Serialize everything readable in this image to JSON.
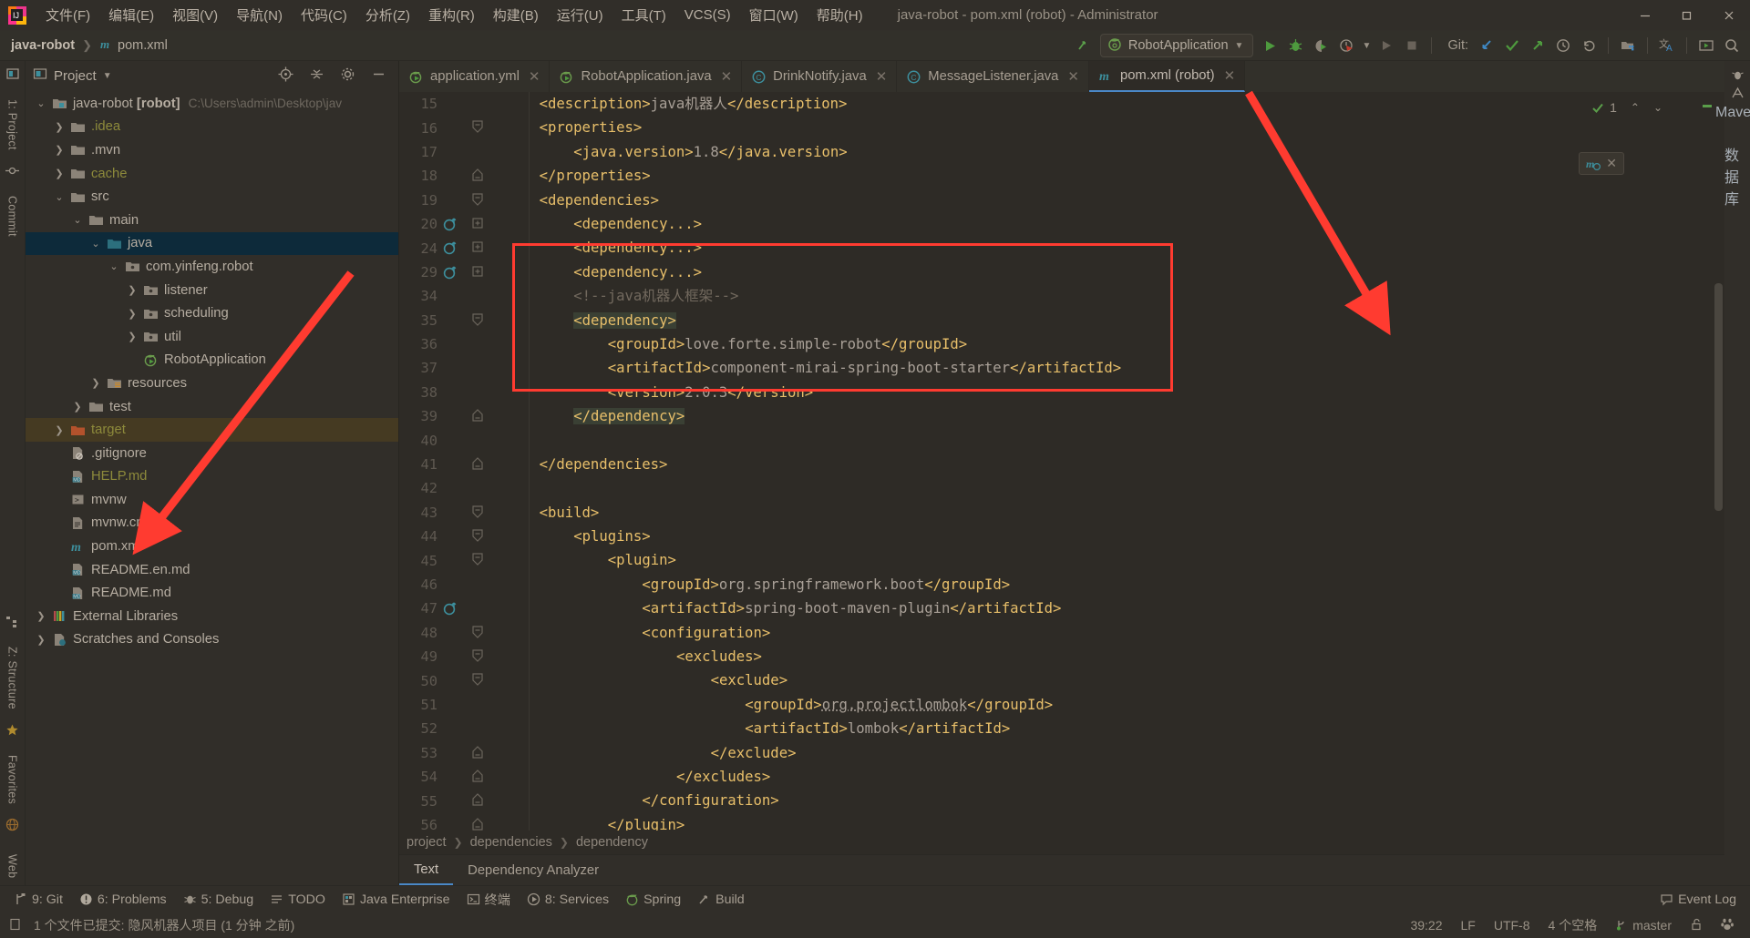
{
  "window": {
    "title": "java-robot - pom.xml (robot) - Administrator",
    "minimize": "—",
    "maximize": "❐",
    "close": "✕"
  },
  "menubar": {
    "items": [
      {
        "label": "文件(F)",
        "mnemonic": "F"
      },
      {
        "label": "编辑(E)",
        "mnemonic": "E"
      },
      {
        "label": "视图(V)",
        "mnemonic": "V"
      },
      {
        "label": "导航(N)",
        "mnemonic": "N"
      },
      {
        "label": "代码(C)",
        "mnemonic": "C"
      },
      {
        "label": "分析(Z)",
        "mnemonic": "Z"
      },
      {
        "label": "重构(R)",
        "mnemonic": "R"
      },
      {
        "label": "构建(B)",
        "mnemonic": "B"
      },
      {
        "label": "运行(U)",
        "mnemonic": "U"
      },
      {
        "label": "工具(T)",
        "mnemonic": "T"
      },
      {
        "label": "VCS(S)",
        "mnemonic": "S"
      },
      {
        "label": "窗口(W)",
        "mnemonic": "W"
      },
      {
        "label": "帮助(H)",
        "mnemonic": "H"
      }
    ]
  },
  "navbar": {
    "breadcrumbs": [
      "java-robot",
      "pom.xml"
    ],
    "run_config": "RobotApplication",
    "git_label": "Git:",
    "icons": [
      "build-icon",
      "run-icon",
      "debug-icon",
      "run-coverage-icon",
      "profile-icon",
      "rerun-icon",
      "stop-icon",
      "git-update-icon",
      "git-commit-icon",
      "git-push-icon",
      "git-history-icon",
      "git-rollback-icon",
      "project-structure-icon",
      "translate-icon",
      "presentation-icon",
      "search-everywhere-icon"
    ]
  },
  "left_rail": {
    "items": [
      {
        "label": "1: Project",
        "name": "tool-project"
      },
      {
        "label": "Commit",
        "name": "tool-commit"
      },
      {
        "label": "Z: Structure",
        "name": "tool-structure"
      },
      {
        "label": "Favorites",
        "name": "tool-favorites"
      },
      {
        "label": "Web",
        "name": "tool-web"
      }
    ]
  },
  "right_rail": {
    "items": [
      {
        "label": "Notifications",
        "name": "tool-notifications"
      },
      {
        "label": "Maven",
        "name": "tool-maven"
      },
      {
        "label": "数据库",
        "name": "tool-database"
      }
    ]
  },
  "project_panel": {
    "title": "Project",
    "dropdown_caret": "▾",
    "actions": [
      "locate-icon",
      "collapse-all-icon",
      "settings-icon",
      "hide-icon"
    ],
    "tree": [
      {
        "depth": 0,
        "label": "java-robot",
        "bold_suffix": "[robot]",
        "path": "C:\\Users\\admin\\Desktop\\jav",
        "icon": "module-folder-icon",
        "arrow": "expanded",
        "state": "normal"
      },
      {
        "depth": 1,
        "label": ".idea",
        "icon": "folder-icon",
        "arrow": "collapsed",
        "state": "excluded"
      },
      {
        "depth": 1,
        "label": ".mvn",
        "icon": "folder-icon",
        "arrow": "collapsed",
        "state": "normal"
      },
      {
        "depth": 1,
        "label": "cache",
        "icon": "folder-icon",
        "arrow": "collapsed",
        "state": "excluded"
      },
      {
        "depth": 1,
        "label": "src",
        "icon": "folder-icon",
        "arrow": "expanded",
        "state": "normal"
      },
      {
        "depth": 2,
        "label": "main",
        "icon": "folder-icon",
        "arrow": "expanded",
        "state": "normal"
      },
      {
        "depth": 3,
        "label": "java",
        "icon": "source-folder-icon",
        "arrow": "expanded",
        "state": "selected"
      },
      {
        "depth": 4,
        "label": "com.yinfeng.robot",
        "icon": "package-icon",
        "arrow": "expanded",
        "state": "normal"
      },
      {
        "depth": 5,
        "label": "listener",
        "icon": "package-icon",
        "arrow": "collapsed",
        "state": "normal"
      },
      {
        "depth": 5,
        "label": "scheduling",
        "icon": "package-icon",
        "arrow": "collapsed",
        "state": "normal"
      },
      {
        "depth": 5,
        "label": "util",
        "icon": "package-icon",
        "arrow": "collapsed",
        "state": "normal"
      },
      {
        "depth": 5,
        "label": "RobotApplication",
        "icon": "spring-class-icon",
        "arrow": "none",
        "state": "normal"
      },
      {
        "depth": 3,
        "label": "resources",
        "icon": "resource-folder-icon",
        "arrow": "collapsed",
        "state": "normal"
      },
      {
        "depth": 2,
        "label": "test",
        "icon": "folder-icon",
        "arrow": "collapsed",
        "state": "normal"
      },
      {
        "depth": 1,
        "label": "target",
        "icon": "excluded-folder-icon",
        "arrow": "collapsed",
        "state": "target"
      },
      {
        "depth": 1,
        "label": ".gitignore",
        "icon": "gitignore-file-icon",
        "arrow": "none",
        "state": "normal"
      },
      {
        "depth": 1,
        "label": "HELP.md",
        "icon": "markdown-file-icon",
        "arrow": "none",
        "state": "md"
      },
      {
        "depth": 1,
        "label": "mvnw",
        "icon": "script-file-icon",
        "arrow": "none",
        "state": "normal"
      },
      {
        "depth": 1,
        "label": "mvnw.cmd",
        "icon": "text-file-icon",
        "arrow": "none",
        "state": "normal"
      },
      {
        "depth": 1,
        "label": "pom.xml",
        "icon": "maven-file-icon",
        "arrow": "none",
        "state": "normal"
      },
      {
        "depth": 1,
        "label": "README.en.md",
        "icon": "markdown-file-icon",
        "arrow": "none",
        "state": "normal"
      },
      {
        "depth": 1,
        "label": "README.md",
        "icon": "markdown-file-icon",
        "arrow": "none",
        "state": "normal"
      },
      {
        "depth": 0,
        "label": "External Libraries",
        "icon": "libraries-icon",
        "arrow": "collapsed",
        "state": "normal"
      },
      {
        "depth": 0,
        "label": "Scratches and Consoles",
        "icon": "scratches-icon",
        "arrow": "collapsed",
        "state": "normal"
      }
    ]
  },
  "editor_tabs": [
    {
      "label": "application.yml",
      "icon": "spring-yaml-icon",
      "active": false
    },
    {
      "label": "RobotApplication.java",
      "icon": "spring-class-icon",
      "active": false
    },
    {
      "label": "DrinkNotify.java",
      "icon": "java-class-icon",
      "active": false
    },
    {
      "label": "MessageListener.java",
      "icon": "java-class-icon",
      "active": false
    },
    {
      "label": "pom.xml (robot)",
      "icon": "maven-file-icon",
      "active": true
    }
  ],
  "editor": {
    "inspection_count": "1",
    "lines": [
      {
        "num": "15",
        "fold": "none",
        "gutter_icon": "none",
        "indent": 1,
        "segs": [
          {
            "t": "<description>",
            "c": "tag"
          },
          {
            "t": "java机器人",
            "c": "txt"
          },
          {
            "t": "</description>",
            "c": "tag"
          }
        ]
      },
      {
        "num": "16",
        "fold": "open",
        "gutter_icon": "none",
        "indent": 1,
        "segs": [
          {
            "t": "<properties>",
            "c": "tag"
          }
        ]
      },
      {
        "num": "17",
        "fold": "none",
        "gutter_icon": "none",
        "indent": 2,
        "segs": [
          {
            "t": "<java.version>",
            "c": "tag"
          },
          {
            "t": "1.8",
            "c": "txt"
          },
          {
            "t": "</java.version>",
            "c": "tag"
          }
        ]
      },
      {
        "num": "18",
        "fold": "close",
        "gutter_icon": "none",
        "indent": 1,
        "segs": [
          {
            "t": "</properties>",
            "c": "tag"
          }
        ]
      },
      {
        "num": "19",
        "fold": "open",
        "gutter_icon": "none",
        "indent": 1,
        "segs": [
          {
            "t": "<dependencies>",
            "c": "tag"
          }
        ]
      },
      {
        "num": "20",
        "fold": "plus",
        "gutter_icon": "dependency-update",
        "indent": 2,
        "segs": [
          {
            "t": "<dependency...>",
            "c": "tag"
          }
        ]
      },
      {
        "num": "24",
        "fold": "plus",
        "gutter_icon": "dependency-update",
        "indent": 2,
        "segs": [
          {
            "t": "<dependency...>",
            "c": "tag"
          }
        ]
      },
      {
        "num": "29",
        "fold": "plus",
        "gutter_icon": "dependency-update",
        "indent": 2,
        "segs": [
          {
            "t": "<dependency...>",
            "c": "tag"
          }
        ]
      },
      {
        "num": "34",
        "fold": "none",
        "gutter_icon": "none",
        "indent": 2,
        "segs": [
          {
            "t": "<!--java机器人框架-->",
            "c": "cmt"
          }
        ]
      },
      {
        "num": "35",
        "fold": "open",
        "gutter_icon": "none",
        "indent": 2,
        "highlight": true,
        "segs": [
          {
            "t": "<dependency>",
            "c": "tag"
          }
        ]
      },
      {
        "num": "36",
        "fold": "none",
        "gutter_icon": "none",
        "indent": 3,
        "segs": [
          {
            "t": "<groupId>",
            "c": "tag"
          },
          {
            "t": "love.forte.simple-robot",
            "c": "txt"
          },
          {
            "t": "</groupId>",
            "c": "tag"
          }
        ]
      },
      {
        "num": "37",
        "fold": "none",
        "gutter_icon": "none",
        "indent": 3,
        "segs": [
          {
            "t": "<artifactId>",
            "c": "tag"
          },
          {
            "t": "component-mirai-spring-boot-starter",
            "c": "txt"
          },
          {
            "t": "</artifactId>",
            "c": "tag"
          }
        ]
      },
      {
        "num": "38",
        "fold": "none",
        "gutter_icon": "none",
        "indent": 3,
        "segs": [
          {
            "t": "<version>",
            "c": "tag"
          },
          {
            "t": "2.0.3",
            "c": "txt"
          },
          {
            "t": "</version>",
            "c": "tag"
          }
        ]
      },
      {
        "num": "39",
        "fold": "close",
        "gutter_icon": "none",
        "indent": 2,
        "highlight": true,
        "segs": [
          {
            "t": "</dependency>",
            "c": "tag"
          }
        ]
      },
      {
        "num": "40",
        "fold": "none",
        "gutter_icon": "none",
        "indent": 0,
        "segs": []
      },
      {
        "num": "41",
        "fold": "close",
        "gutter_icon": "none",
        "indent": 1,
        "segs": [
          {
            "t": "</dependencies>",
            "c": "tag"
          }
        ]
      },
      {
        "num": "42",
        "fold": "none",
        "gutter_icon": "none",
        "indent": 0,
        "segs": []
      },
      {
        "num": "43",
        "fold": "open",
        "gutter_icon": "none",
        "indent": 1,
        "segs": [
          {
            "t": "<build>",
            "c": "tag"
          }
        ]
      },
      {
        "num": "44",
        "fold": "open",
        "gutter_icon": "none",
        "indent": 2,
        "segs": [
          {
            "t": "<plugins>",
            "c": "tag"
          }
        ]
      },
      {
        "num": "45",
        "fold": "open",
        "gutter_icon": "none",
        "indent": 3,
        "segs": [
          {
            "t": "<plugin>",
            "c": "tag"
          }
        ]
      },
      {
        "num": "46",
        "fold": "none",
        "gutter_icon": "none",
        "indent": 4,
        "segs": [
          {
            "t": "<groupId>",
            "c": "tag"
          },
          {
            "t": "org.springframework.boot",
            "c": "txt"
          },
          {
            "t": "</groupId>",
            "c": "tag"
          }
        ]
      },
      {
        "num": "47",
        "fold": "none",
        "gutter_icon": "dependency-update",
        "indent": 4,
        "segs": [
          {
            "t": "<artifactId>",
            "c": "tag"
          },
          {
            "t": "spring-boot-maven-plugin",
            "c": "txt"
          },
          {
            "t": "</artifactId>",
            "c": "tag"
          }
        ]
      },
      {
        "num": "48",
        "fold": "open",
        "gutter_icon": "none",
        "indent": 4,
        "segs": [
          {
            "t": "<configuration>",
            "c": "tag"
          }
        ]
      },
      {
        "num": "49",
        "fold": "open",
        "gutter_icon": "none",
        "indent": 5,
        "segs": [
          {
            "t": "<excludes>",
            "c": "tag"
          }
        ]
      },
      {
        "num": "50",
        "fold": "open",
        "gutter_icon": "none",
        "indent": 6,
        "segs": [
          {
            "t": "<exclude>",
            "c": "tag"
          }
        ]
      },
      {
        "num": "51",
        "fold": "none",
        "gutter_icon": "none",
        "indent": 7,
        "segs": [
          {
            "t": "<groupId>",
            "c": "tag"
          },
          {
            "t": "org.projectlombok",
            "c": "txt",
            "underline": true
          },
          {
            "t": "</groupId>",
            "c": "tag"
          }
        ]
      },
      {
        "num": "52",
        "fold": "none",
        "gutter_icon": "none",
        "indent": 7,
        "segs": [
          {
            "t": "<artifactId>",
            "c": "tag"
          },
          {
            "t": "lombok",
            "c": "txt"
          },
          {
            "t": "</artifactId>",
            "c": "tag"
          }
        ]
      },
      {
        "num": "53",
        "fold": "close",
        "gutter_icon": "none",
        "indent": 6,
        "segs": [
          {
            "t": "</exclude>",
            "c": "tag"
          }
        ]
      },
      {
        "num": "54",
        "fold": "close",
        "gutter_icon": "none",
        "indent": 5,
        "segs": [
          {
            "t": "</excludes>",
            "c": "tag"
          }
        ]
      },
      {
        "num": "55",
        "fold": "close",
        "gutter_icon": "none",
        "indent": 4,
        "segs": [
          {
            "t": "</configuration>",
            "c": "tag"
          }
        ]
      },
      {
        "num": "56",
        "fold": "close",
        "gutter_icon": "none",
        "indent": 3,
        "segs": [
          {
            "t": "</plugin>",
            "c": "tag"
          }
        ]
      }
    ]
  },
  "breadcrumb_bar": [
    "project",
    "dependencies",
    "dependency"
  ],
  "editor_bottom_tabs": [
    {
      "label": "Text",
      "active": true
    },
    {
      "label": "Dependency Analyzer",
      "active": false
    }
  ],
  "bottom_toolwindows": [
    {
      "label": "9: Git",
      "icon": "git-icon"
    },
    {
      "label": "6: Problems",
      "icon": "problems-icon"
    },
    {
      "label": "5: Debug",
      "icon": "debug-icon"
    },
    {
      "label": "TODO",
      "icon": "todo-icon"
    },
    {
      "label": "Java Enterprise",
      "icon": "java-enterprise-icon"
    },
    {
      "label": "终端",
      "icon": "terminal-icon"
    },
    {
      "label": "8: Services",
      "icon": "services-icon"
    },
    {
      "label": "Spring",
      "icon": "spring-icon"
    },
    {
      "label": "Build",
      "icon": "build-icon"
    }
  ],
  "event_log": "Event Log",
  "statusbar": {
    "message": "1 个文件已提交: 隐风机器人项目 (1 分钟 之前)",
    "caret": "39:22",
    "line_separator": "LF",
    "encoding": "UTF-8",
    "indent": "4 个空格",
    "branch": "master",
    "lock_icon": "unlocked-icon",
    "extra_icon": "baidu-icon"
  },
  "colors": {
    "accent_blue": "#4a88c7",
    "annotation_red": "#ff3b30",
    "selection_blue": "#0d2a3a",
    "tag": "#e8bf6a",
    "comment": "#72695e",
    "green": "#4e9a3e"
  }
}
